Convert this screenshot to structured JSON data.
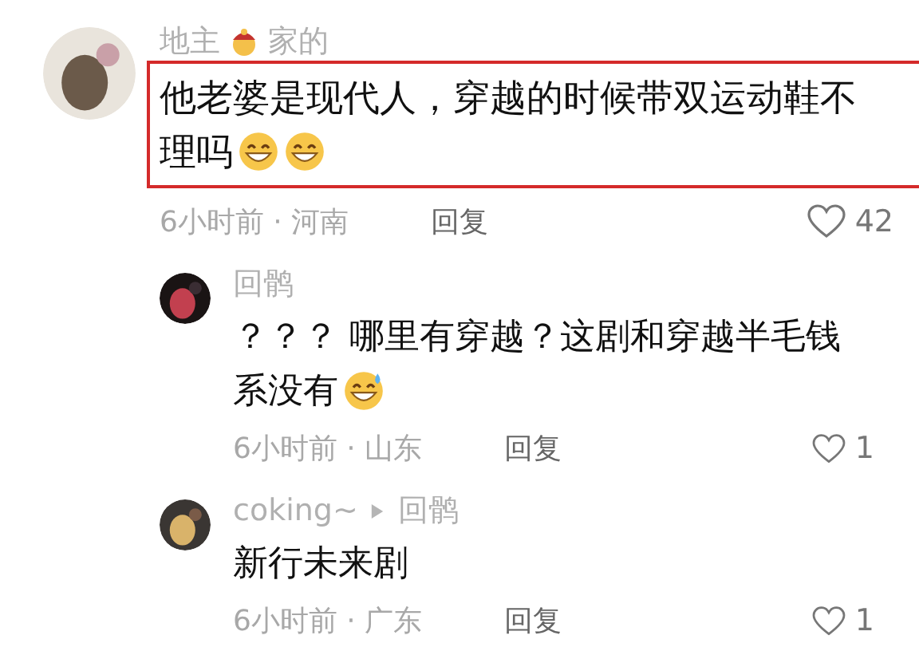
{
  "comments": [
    {
      "kind": "top",
      "author": [
        {
          "kind": "text",
          "text": "地主"
        },
        {
          "kind": "emoji"
        },
        {
          "kind": "text",
          "text": "家的"
        }
      ],
      "highlighted": true,
      "lines": [
        {
          "text": "他老婆是现代人，穿越的时候带双运动鞋不"
        },
        {
          "text": "理吗",
          "emojis": [
            {
              "kind": "grin"
            },
            {
              "kind": "grin"
            }
          ]
        }
      ],
      "time_place": "6小时前 · 河南",
      "reply_label": "回复",
      "likes": "42"
    },
    {
      "kind": "reply",
      "author": [
        {
          "kind": "text",
          "text": "回鹘"
        }
      ],
      "highlighted": false,
      "lines": [
        {
          "text": "？？？ 哪里有穿越？这剧和穿越半毛钱"
        },
        {
          "text": "系没有",
          "emojis": [
            {
              "kind": "sweat"
            }
          ]
        }
      ],
      "time_place": "6小时前 · 山东",
      "reply_label": "回复",
      "likes": "1"
    },
    {
      "kind": "reply",
      "author": [
        {
          "kind": "text",
          "text": "coking~"
        },
        {
          "kind": "arrow"
        },
        {
          "kind": "text",
          "text": "回鹘"
        }
      ],
      "highlighted": false,
      "lines": [
        {
          "text": "新行未来剧"
        }
      ],
      "time_place": "6小时前 · 广东",
      "reply_label": "回复",
      "likes": "1"
    }
  ]
}
